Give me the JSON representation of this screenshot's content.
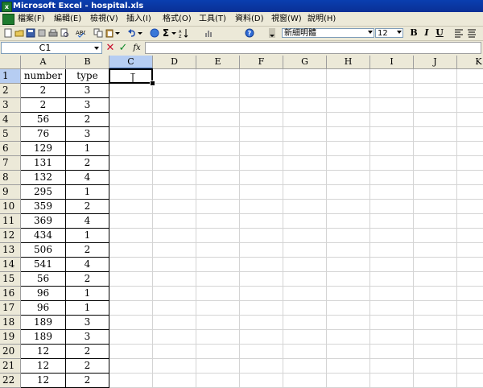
{
  "window": {
    "title": "Microsoft Excel - hospital.xls"
  },
  "menu": [
    {
      "label": "檔案(F)"
    },
    {
      "label": "編輯(E)"
    },
    {
      "label": "檢視(V)"
    },
    {
      "label": "插入(I)"
    },
    {
      "label": "格式(O)"
    },
    {
      "label": "工具(T)"
    },
    {
      "label": "資料(D)"
    },
    {
      "label": "視窗(W)"
    },
    {
      "label": "說明(H)"
    }
  ],
  "toolbar": {
    "font_name": "新細明體",
    "font_size": "12",
    "sigma": "Σ",
    "bold": "B",
    "italic": "I",
    "underline": "U"
  },
  "formula_bar": {
    "name_box": "C1",
    "fx": "fx",
    "content": ""
  },
  "sheet": {
    "columns": [
      "A",
      "B",
      "C",
      "D",
      "E",
      "F",
      "G",
      "H",
      "I",
      "J",
      "K"
    ],
    "active_column": "C",
    "active_row": 1,
    "rows": [
      {
        "n": "1",
        "a": "number",
        "b": "type"
      },
      {
        "n": "2",
        "a": "2",
        "b": "3"
      },
      {
        "n": "3",
        "a": "2",
        "b": "3"
      },
      {
        "n": "4",
        "a": "56",
        "b": "2"
      },
      {
        "n": "5",
        "a": "76",
        "b": "3"
      },
      {
        "n": "6",
        "a": "129",
        "b": "1"
      },
      {
        "n": "7",
        "a": "131",
        "b": "2"
      },
      {
        "n": "8",
        "a": "132",
        "b": "4"
      },
      {
        "n": "9",
        "a": "295",
        "b": "1"
      },
      {
        "n": "10",
        "a": "359",
        "b": "2"
      },
      {
        "n": "11",
        "a": "369",
        "b": "4"
      },
      {
        "n": "12",
        "a": "434",
        "b": "1"
      },
      {
        "n": "13",
        "a": "506",
        "b": "2"
      },
      {
        "n": "14",
        "a": "541",
        "b": "4"
      },
      {
        "n": "15",
        "a": "56",
        "b": "2"
      },
      {
        "n": "16",
        "a": "96",
        "b": "1"
      },
      {
        "n": "17",
        "a": "96",
        "b": "1"
      },
      {
        "n": "18",
        "a": "189",
        "b": "3"
      },
      {
        "n": "19",
        "a": "189",
        "b": "3"
      },
      {
        "n": "20",
        "a": "12",
        "b": "2"
      },
      {
        "n": "21",
        "a": "12",
        "b": "2"
      },
      {
        "n": "22",
        "a": "12",
        "b": "2"
      }
    ]
  }
}
